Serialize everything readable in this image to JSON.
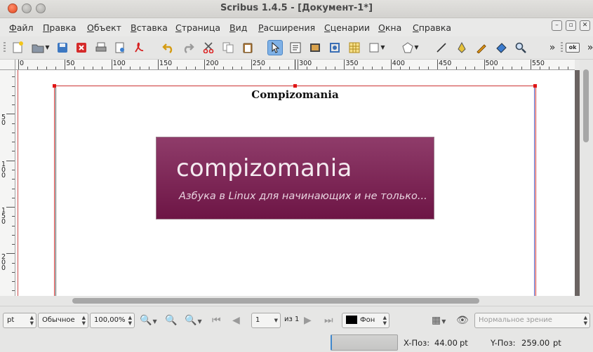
{
  "window": {
    "title": "Scribus 1.4.5 - [Документ-1*]"
  },
  "menu": [
    {
      "label": "Файл",
      "ul": "Ф",
      "rest": "айл"
    },
    {
      "label": "Правка",
      "ul": "П",
      "rest": "равка"
    },
    {
      "label": "Объект",
      "ul": "О",
      "rest": "бъект"
    },
    {
      "label": "Вставка",
      "ul": "В",
      "rest": "ставка"
    },
    {
      "label": "Страница",
      "ul": "С",
      "rest": "траница"
    },
    {
      "label": "Вид",
      "ul": "В",
      "rest": "ид"
    },
    {
      "label": "Расширения",
      "ul": "Р",
      "rest": "асширения"
    },
    {
      "label": "Сценарии",
      "ul": "С",
      "rest": "ценарии"
    },
    {
      "label": "Окна",
      "ul": "О",
      "rest": "кна"
    },
    {
      "label": "Справка",
      "ul": "С",
      "rest": "правка"
    }
  ],
  "toolbar": {
    "icons": [
      "new-document-icon",
      "open-icon",
      "save-icon",
      "close-document-icon",
      "print-icon",
      "preflight-icon",
      "pdf-export-icon",
      "undo-icon",
      "redo-icon",
      "cut-icon",
      "copy-icon",
      "paste-icon",
      "select-tool-icon",
      "text-frame-icon",
      "image-frame-icon",
      "render-frame-icon",
      "table-icon",
      "shape-icon",
      "polygon-icon",
      "line-icon",
      "bezier-icon",
      "freehand-icon",
      "rotate-icon",
      "zoom-icon"
    ],
    "overflow_label": "»",
    "ok_label": "ok"
  },
  "ruler": {
    "h_labels": [
      "0",
      "50",
      "100",
      "150",
      "200",
      "250",
      "300",
      "350",
      "400",
      "450",
      "500",
      "550"
    ],
    "v_labels": [
      "5\n0",
      "1\n0\n0",
      "1\n5\n0",
      "2\n0\n0",
      "2\n5"
    ]
  },
  "document": {
    "heading": "Compizomania",
    "banner_title": "compizomania",
    "banner_subtitle": "Азбука в Linux для начинающих и не только...",
    "banner_colors": [
      "#8f3c6a",
      "#6d1545"
    ]
  },
  "bottom": {
    "unit": "pt",
    "mode": "Обычное",
    "zoom": "100,00%",
    "page": "1",
    "page_of": "из 1",
    "layer": "Фон",
    "view_mode_placeholder": "Нормальное зрение"
  },
  "status": {
    "x_label": "X-Поз:",
    "x_value": "44.00",
    "x_unit": "pt",
    "y_label": "Y-Поз:",
    "y_value": "259.00",
    "y_unit": "pt"
  }
}
